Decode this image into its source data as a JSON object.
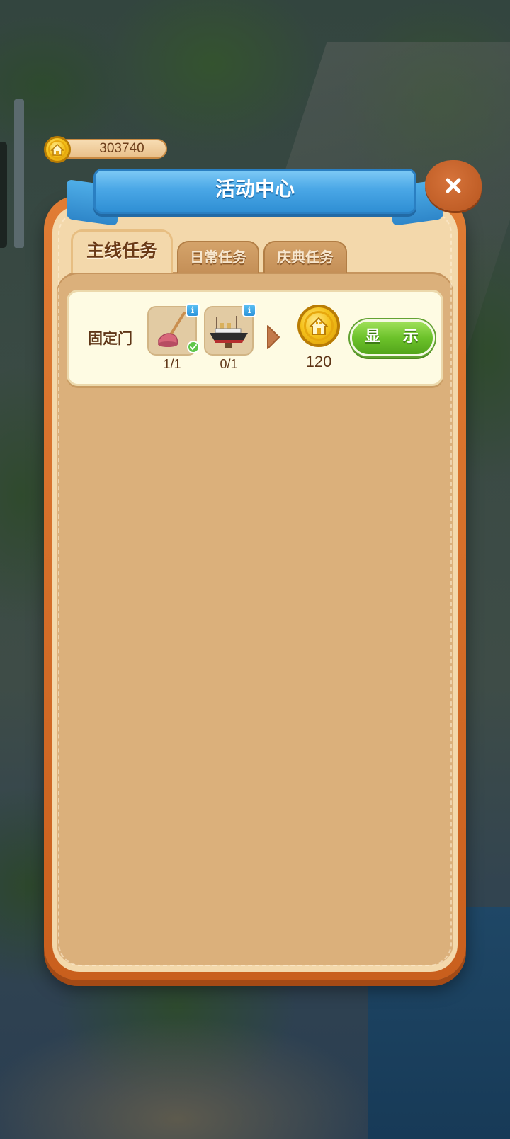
{
  "currency": {
    "amount": "303740",
    "icon": "house-coin-icon"
  },
  "panel": {
    "title": "活动中心",
    "close_icon": "close-icon"
  },
  "tabs": [
    {
      "label": "主线任务",
      "active": true
    },
    {
      "label": "日常任务",
      "active": false
    },
    {
      "label": "庆典任务",
      "active": false
    }
  ],
  "quests": [
    {
      "name": "固定门",
      "requirements": [
        {
          "item_icon": "plunger-icon",
          "progress": "1/1",
          "completed": true
        },
        {
          "item_icon": "ship-model-icon",
          "progress": "0/1",
          "completed": false
        }
      ],
      "reward": {
        "icon": "house-coin-icon",
        "amount": "120"
      },
      "action_label": "显 示"
    }
  ],
  "colors": {
    "panel_frame": "#e07c34",
    "panel_fill": "#dbb07b",
    "banner_blue": "#4aa7e6",
    "action_green": "#6cc22a",
    "coin_gold": "#f5c21c"
  }
}
